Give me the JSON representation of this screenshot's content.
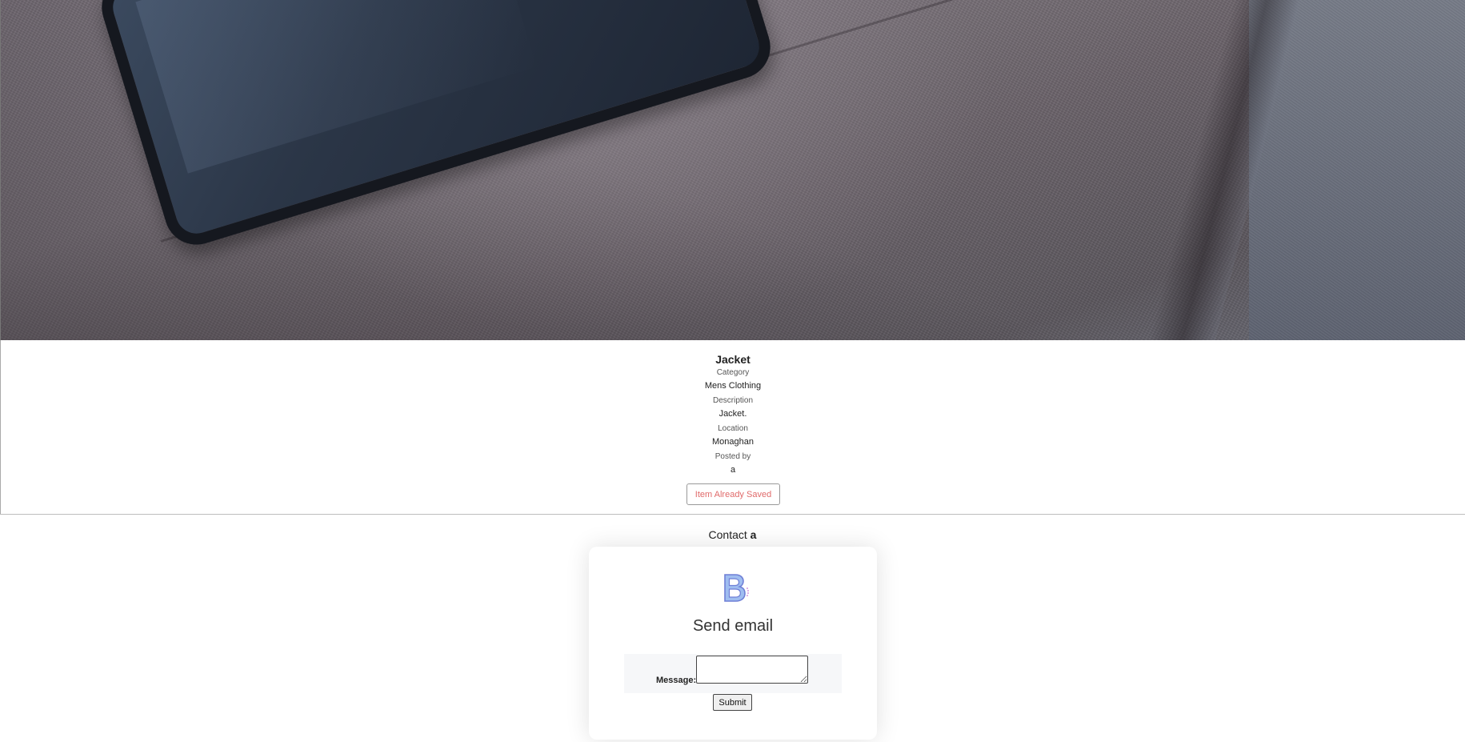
{
  "hero": {
    "image": "sofa-tablet-photo"
  },
  "item": {
    "title": "Jacket",
    "category_label": "Category",
    "category": "Mens Clothing",
    "description_label": "Description",
    "description": "Jacket.",
    "location_label": "Location",
    "location": "Monaghan",
    "posted_by_label": "Posted by",
    "posted_by": "a",
    "saved_button_label": "Item Already Saved"
  },
  "contact": {
    "heading_prefix": "Contact",
    "heading_name": "a",
    "logo_icon": "bootstrap-logo-icon",
    "card_title": "Send email",
    "message_label": "Message:",
    "message_value": "",
    "submit_label": "Submit"
  },
  "colors": {
    "saved_button_text": "#e06a6a",
    "logo_fill": "#8fb0e8",
    "logo_stroke": "#6e7fd6"
  }
}
